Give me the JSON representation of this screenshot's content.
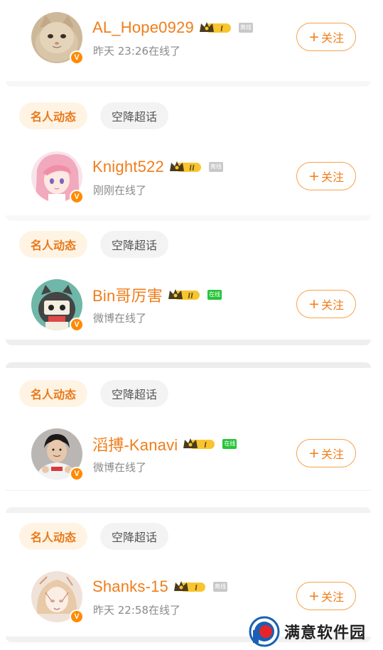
{
  "users": [
    {
      "name": "AL_Hope0929",
      "level": "I",
      "status": "离线",
      "online": false,
      "last_seen": "昨天 23:26在线了",
      "follow_label": "关注",
      "avatar": "cat"
    },
    {
      "name": "Knight522",
      "level": "II",
      "status": "离线",
      "online": false,
      "last_seen": "刚刚在线了",
      "follow_label": "关注",
      "avatar": "anime-girl"
    },
    {
      "name": "Bin哥厉害",
      "level": "II",
      "status": "在线",
      "online": true,
      "last_seen": "微博在线了",
      "follow_label": "关注",
      "avatar": "cartoon-mascot"
    },
    {
      "name": "滔搏-Kanavi",
      "level": "I",
      "status": "在线",
      "online": true,
      "last_seen": "微博在线了",
      "follow_label": "关注",
      "avatar": "player-photo"
    },
    {
      "name": "Shanks-15",
      "level": "I",
      "status": "离线",
      "online": false,
      "last_seen": "昨天 22:58在线了",
      "follow_label": "关注",
      "avatar": "sketch-girl"
    }
  ],
  "tags": {
    "celebrity": "名人动态",
    "airdrop": "空降超话"
  },
  "verified_badge": "V",
  "plus_symbol": "+",
  "watermark": {
    "text": "满意软件园",
    "icon": "app-logo-icon"
  },
  "colors": {
    "accent": "#f07d1a",
    "follow_border": "#f6a24a",
    "online": "#27c43a",
    "offline": "#c8c8c8"
  }
}
